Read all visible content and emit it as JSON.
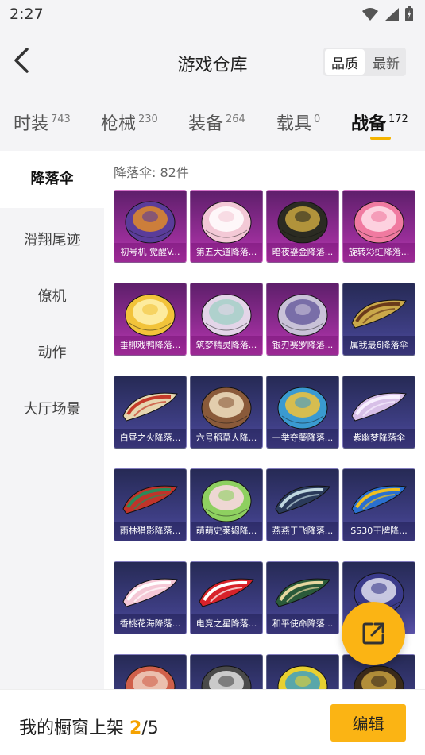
{
  "status_bar": {
    "time": "2:27"
  },
  "header": {
    "title": "游戏仓库",
    "sort_options": [
      "品质",
      "最新"
    ],
    "sort_selected": "品质"
  },
  "tabs": [
    {
      "label": "时装",
      "count": "743"
    },
    {
      "label": "枪械",
      "count": "230"
    },
    {
      "label": "装备",
      "count": "264"
    },
    {
      "label": "载具",
      "count": "0"
    },
    {
      "label": "战备",
      "count": "172",
      "active": true
    }
  ],
  "sidebar": {
    "items": [
      {
        "label": "降落伞",
        "active": true
      },
      {
        "label": "滑翔尾迹"
      },
      {
        "label": "僚机"
      },
      {
        "label": "动作"
      },
      {
        "label": "大厅场景"
      }
    ]
  },
  "content": {
    "count_label": "降落伞: 82件",
    "items": [
      {
        "name": "初号机 觉醒V...",
        "rarity": "purple"
      },
      {
        "name": "第五大道降落...",
        "rarity": "purple"
      },
      {
        "name": "暗夜鎏金降落...",
        "rarity": "purple"
      },
      {
        "name": "旋转彩虹降落...",
        "rarity": "purple"
      },
      {
        "name": "垂柳戏鸭降落...",
        "rarity": "purple"
      },
      {
        "name": "筑梦精灵降落...",
        "rarity": "purple"
      },
      {
        "name": "银刃赛罗降落...",
        "rarity": "purple"
      },
      {
        "name": "属我最6降落伞",
        "rarity": "blue"
      },
      {
        "name": "白昼之火降落...",
        "rarity": "blue"
      },
      {
        "name": "六号稻草人降...",
        "rarity": "blue"
      },
      {
        "name": "一举夺葵降落...",
        "rarity": "blue"
      },
      {
        "name": "紫幽梦降落伞",
        "rarity": "blue"
      },
      {
        "name": "雨林猎影降落...",
        "rarity": "blue"
      },
      {
        "name": "萌萌史莱姆降...",
        "rarity": "blue"
      },
      {
        "name": "燕燕于飞降落...",
        "rarity": "blue"
      },
      {
        "name": "SS30王牌降...",
        "rarity": "blue"
      },
      {
        "name": "香桃花海降落...",
        "rarity": "blue"
      },
      {
        "name": "电竞之星降落...",
        "rarity": "blue"
      },
      {
        "name": "和平使命降落...",
        "rarity": "blue"
      },
      {
        "name": "",
        "rarity": "blue"
      },
      {
        "name": "",
        "rarity": "blue"
      },
      {
        "name": "",
        "rarity": "blue"
      },
      {
        "name": "",
        "rarity": "blue"
      },
      {
        "name": "",
        "rarity": "blue"
      }
    ]
  },
  "bottom_bar": {
    "label": "我的橱窗上架 ",
    "current": "2",
    "separator": "/",
    "total": "5",
    "edit_label": "编辑"
  },
  "colors": {
    "accent": "#fbb414",
    "epic": "#9a2e9a",
    "rare": "#3f3f86"
  }
}
